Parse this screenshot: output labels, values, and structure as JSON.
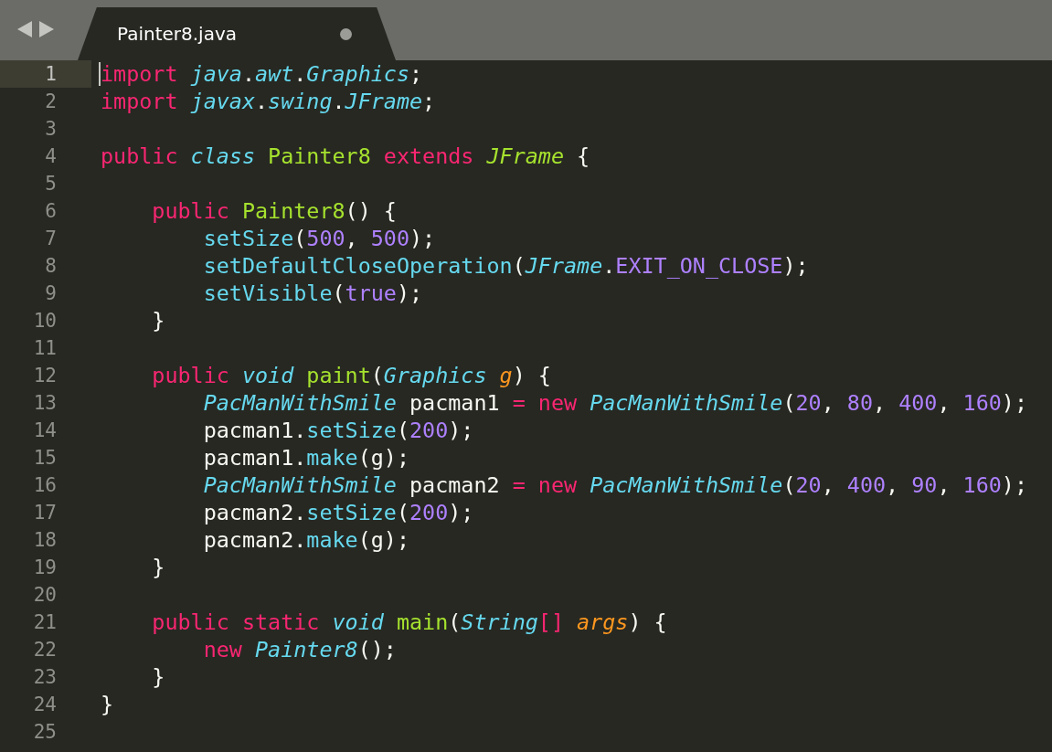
{
  "tabs": [
    {
      "title": "Painter8.java",
      "selected": true,
      "modified": true
    }
  ],
  "editor": {
    "lines": [
      {
        "number": "1",
        "current": true,
        "tokens": [
          {
            "kind": "keyword",
            "text": "import "
          },
          {
            "kind": "storage",
            "text": "java"
          },
          {
            "kind": "plain",
            "text": "."
          },
          {
            "kind": "storage",
            "text": "awt"
          },
          {
            "kind": "plain",
            "text": "."
          },
          {
            "kind": "storage",
            "text": "Graphics"
          },
          {
            "kind": "plain",
            "text": ";"
          }
        ]
      },
      {
        "number": "2",
        "current": false,
        "tokens": [
          {
            "kind": "keyword",
            "text": "import "
          },
          {
            "kind": "storage",
            "text": "javax"
          },
          {
            "kind": "plain",
            "text": "."
          },
          {
            "kind": "storage",
            "text": "swing"
          },
          {
            "kind": "plain",
            "text": "."
          },
          {
            "kind": "storage",
            "text": "JFrame"
          },
          {
            "kind": "plain",
            "text": ";"
          }
        ]
      },
      {
        "number": "3",
        "current": false
      },
      {
        "number": "4",
        "current": false,
        "tokens": [
          {
            "kind": "keyword",
            "text": "public "
          },
          {
            "kind": "storage",
            "text": "class "
          },
          {
            "kind": "entity",
            "text": "Painter8 "
          },
          {
            "kind": "keyword",
            "text": "extends "
          },
          {
            "kind": "inherited",
            "text": "JFrame "
          },
          {
            "kind": "plain",
            "text": "{"
          }
        ]
      },
      {
        "number": "5",
        "current": false
      },
      {
        "number": "6",
        "current": false,
        "tokens": [
          {
            "kind": "keyword",
            "text": "    public "
          },
          {
            "kind": "entity",
            "text": "Painter8"
          },
          {
            "kind": "plain",
            "text": "() {"
          }
        ]
      },
      {
        "number": "7",
        "current": false,
        "tokens": [
          {
            "kind": "function",
            "text": "        setSize"
          },
          {
            "kind": "plain",
            "text": "("
          },
          {
            "kind": "number",
            "text": "500"
          },
          {
            "kind": "plain",
            "text": ", "
          },
          {
            "kind": "number",
            "text": "500"
          },
          {
            "kind": "plain",
            "text": ");"
          }
        ]
      },
      {
        "number": "8",
        "current": false,
        "tokens": [
          {
            "kind": "function",
            "text": "        setDefaultCloseOperation"
          },
          {
            "kind": "plain",
            "text": "("
          },
          {
            "kind": "storage",
            "text": "JFrame"
          },
          {
            "kind": "plain",
            "text": "."
          },
          {
            "kind": "number",
            "text": "EXIT_ON_CLOSE"
          },
          {
            "kind": "plain",
            "text": ");"
          }
        ]
      },
      {
        "number": "9",
        "current": false,
        "tokens": [
          {
            "kind": "function",
            "text": "        setVisible"
          },
          {
            "kind": "plain",
            "text": "("
          },
          {
            "kind": "number",
            "text": "true"
          },
          {
            "kind": "plain",
            "text": ");"
          }
        ]
      },
      {
        "number": "10",
        "current": false,
        "tokens": [
          {
            "kind": "plain",
            "text": "    }"
          }
        ]
      },
      {
        "number": "11",
        "current": false
      },
      {
        "number": "12",
        "current": false,
        "tokens": [
          {
            "kind": "keyword",
            "text": "    public "
          },
          {
            "kind": "storage",
            "text": "void "
          },
          {
            "kind": "entity",
            "text": "paint"
          },
          {
            "kind": "plain",
            "text": "("
          },
          {
            "kind": "storage",
            "text": "Graphics "
          },
          {
            "kind": "parameter",
            "text": "g"
          },
          {
            "kind": "plain",
            "text": ") {"
          }
        ]
      },
      {
        "number": "13",
        "current": false,
        "tokens": [
          {
            "kind": "storage",
            "text": "        PacManWithSmile"
          },
          {
            "kind": "plain",
            "text": " pacman1 "
          },
          {
            "kind": "keyword",
            "text": "= new "
          },
          {
            "kind": "storage",
            "text": "PacManWithSmile"
          },
          {
            "kind": "plain",
            "text": "("
          },
          {
            "kind": "number",
            "text": "20"
          },
          {
            "kind": "plain",
            "text": ", "
          },
          {
            "kind": "number",
            "text": "80"
          },
          {
            "kind": "plain",
            "text": ", "
          },
          {
            "kind": "number",
            "text": "400"
          },
          {
            "kind": "plain",
            "text": ", "
          },
          {
            "kind": "number",
            "text": "160"
          },
          {
            "kind": "plain",
            "text": ");"
          }
        ]
      },
      {
        "number": "14",
        "current": false,
        "tokens": [
          {
            "kind": "plain",
            "text": "        pacman1."
          },
          {
            "kind": "function",
            "text": "setSize"
          },
          {
            "kind": "plain",
            "text": "("
          },
          {
            "kind": "number",
            "text": "200"
          },
          {
            "kind": "plain",
            "text": ");"
          }
        ]
      },
      {
        "number": "15",
        "current": false,
        "tokens": [
          {
            "kind": "plain",
            "text": "        pacman1."
          },
          {
            "kind": "function",
            "text": "make"
          },
          {
            "kind": "plain",
            "text": "(g);"
          }
        ]
      },
      {
        "number": "16",
        "current": false,
        "tokens": [
          {
            "kind": "storage",
            "text": "        PacManWithSmile"
          },
          {
            "kind": "plain",
            "text": " pacman2 "
          },
          {
            "kind": "keyword",
            "text": "= new "
          },
          {
            "kind": "storage",
            "text": "PacManWithSmile"
          },
          {
            "kind": "plain",
            "text": "("
          },
          {
            "kind": "number",
            "text": "20"
          },
          {
            "kind": "plain",
            "text": ", "
          },
          {
            "kind": "number",
            "text": "400"
          },
          {
            "kind": "plain",
            "text": ", "
          },
          {
            "kind": "number",
            "text": "90"
          },
          {
            "kind": "plain",
            "text": ", "
          },
          {
            "kind": "number",
            "text": "160"
          },
          {
            "kind": "plain",
            "text": ");"
          }
        ]
      },
      {
        "number": "17",
        "current": false,
        "tokens": [
          {
            "kind": "plain",
            "text": "        pacman2."
          },
          {
            "kind": "function",
            "text": "setSize"
          },
          {
            "kind": "plain",
            "text": "("
          },
          {
            "kind": "number",
            "text": "200"
          },
          {
            "kind": "plain",
            "text": ");"
          }
        ]
      },
      {
        "number": "18",
        "current": false,
        "tokens": [
          {
            "kind": "plain",
            "text": "        pacman2."
          },
          {
            "kind": "function",
            "text": "make"
          },
          {
            "kind": "plain",
            "text": "(g);"
          }
        ]
      },
      {
        "number": "19",
        "current": false,
        "tokens": [
          {
            "kind": "plain",
            "text": "    }"
          }
        ]
      },
      {
        "number": "20",
        "current": false
      },
      {
        "number": "21",
        "current": false,
        "tokens": [
          {
            "kind": "keyword",
            "text": "    public static "
          },
          {
            "kind": "storage",
            "text": "void "
          },
          {
            "kind": "entity",
            "text": "main"
          },
          {
            "kind": "plain",
            "text": "("
          },
          {
            "kind": "storage",
            "text": "String"
          },
          {
            "kind": "keyword",
            "text": "[] "
          },
          {
            "kind": "parameter",
            "text": "args"
          },
          {
            "kind": "plain",
            "text": ") {"
          }
        ]
      },
      {
        "number": "22",
        "current": false,
        "tokens": [
          {
            "kind": "keyword",
            "text": "        new "
          },
          {
            "kind": "storage",
            "text": "Painter8"
          },
          {
            "kind": "plain",
            "text": "();"
          }
        ]
      },
      {
        "number": "23",
        "current": false,
        "tokens": [
          {
            "kind": "plain",
            "text": "    }"
          }
        ]
      },
      {
        "number": "24",
        "current": false,
        "tokens": [
          {
            "kind": "plain",
            "text": "}"
          }
        ]
      },
      {
        "number": "25",
        "current": false
      }
    ]
  }
}
